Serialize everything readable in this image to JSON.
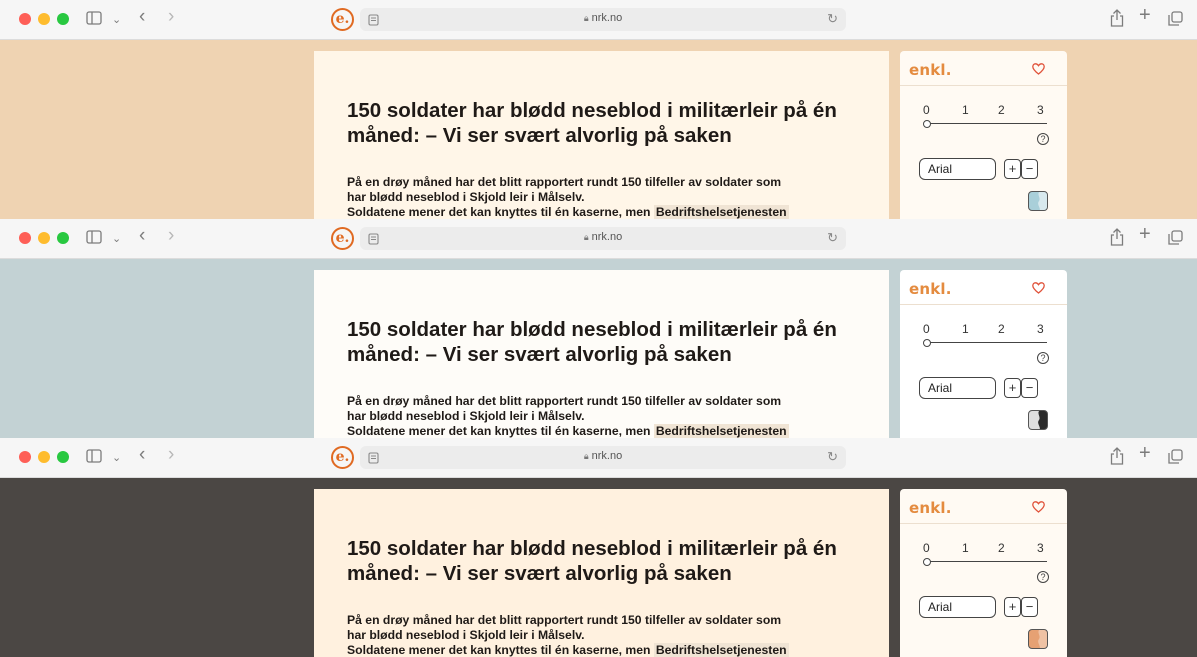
{
  "browser": {
    "url": "nrk.no",
    "lock_icon": "lock-icon",
    "reader_icon": "reader-icon",
    "reload_icon": "reload-icon",
    "extension_letter": "e.",
    "extension_icon": "enkl-extension-icon",
    "toolbar_icons": [
      "sidebar-icon",
      "chevron-down-icon",
      "back-icon",
      "forward-icon",
      "share-icon",
      "new-tab-icon",
      "tabs-overview-icon"
    ]
  },
  "article": {
    "headline": "150 soldater har blødd neseblod i militærleir på én måned: – Vi ser svært alvorlig på saken",
    "lead_line_1": "På en drøy måned har det blitt rapportert rundt 150 tilfeller av soldater som",
    "lead_line_2": "har blødd neseblod i Skjold leir i Målselv.",
    "lead_line_3": "Soldatene mener det kan knyttes til én kaserne, men",
    "lead_highlight": "Bedriftshelsetjenesten"
  },
  "panel": {
    "logo": "enkl.",
    "favorite_icon": "heart-icon",
    "scale_labels": [
      "0",
      "1",
      "2",
      "3"
    ],
    "scale_value": 0,
    "help_label": "?",
    "font_value": "Arial",
    "plus_label": "+",
    "minus_label": "−",
    "theme_icon": "theme-toggle-icon"
  },
  "frames": [
    {
      "theme": "warm",
      "background_color": "#efd3b2",
      "article_color": "#fff6e8",
      "theme_swatch": "#a9cfd9"
    },
    {
      "theme": "light",
      "background_color": "#c3d2d4",
      "article_color": "#fefcf8",
      "theme_swatch": "#2b2b2b"
    },
    {
      "theme": "dark",
      "background_color": "#4b4744",
      "article_color": "#fff1df",
      "theme_swatch": "#e6a173"
    }
  ]
}
